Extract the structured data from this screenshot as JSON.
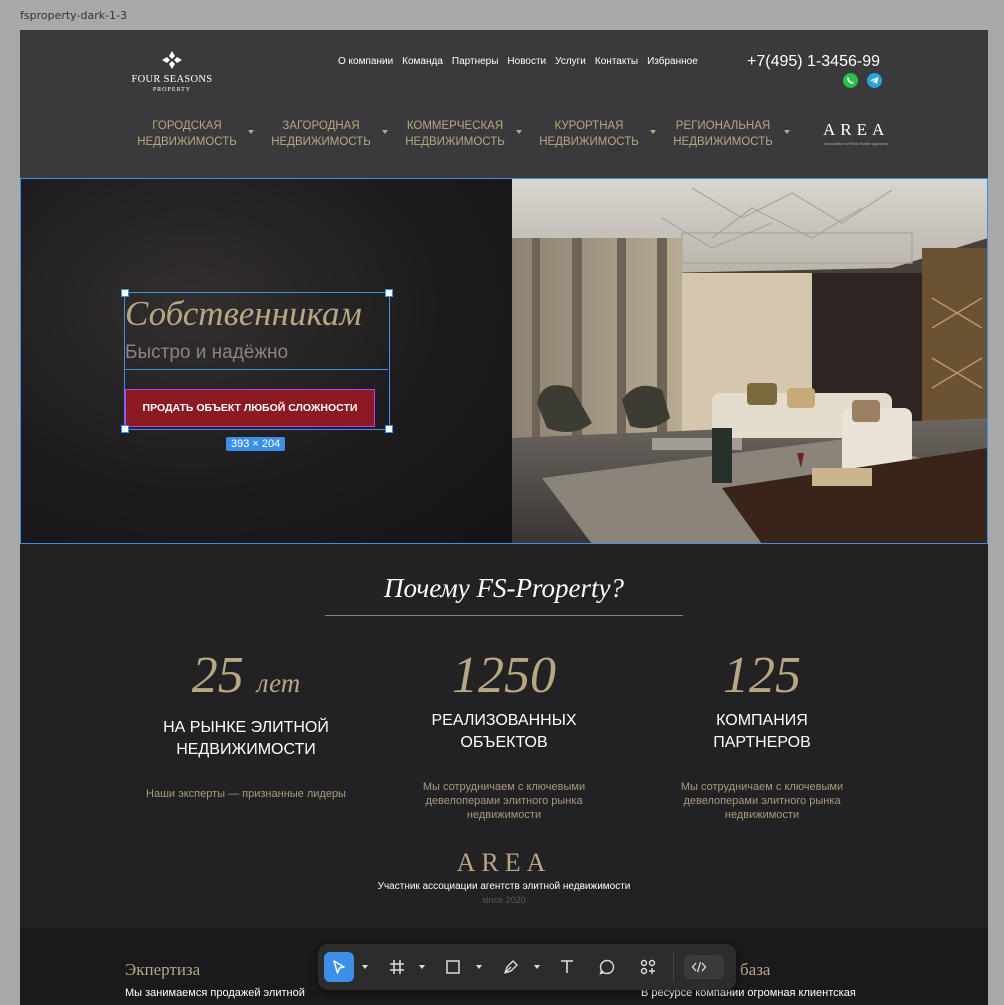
{
  "frame": {
    "title": "fsproperty-dark-1-3"
  },
  "logo": {
    "name": "FOUR SEASONS",
    "sub": "PROPERTY"
  },
  "topnav": [
    "О компании",
    "Команда",
    "Партнеры",
    "Новости",
    "Услуги",
    "Контакты",
    "Избранное"
  ],
  "contact": {
    "phone": "+7(495) 1-3456-99"
  },
  "mainnav": [
    {
      "line1": "ГОРОДСКАЯ",
      "line2": "НЕДВИЖИМОСТЬ"
    },
    {
      "line1": "ЗАГОРОДНАЯ",
      "line2": "НЕДВИЖИМОСТЬ"
    },
    {
      "line1": "КОММЕРЧЕСКАЯ",
      "line2": "НЕДВИЖИМОСТЬ"
    },
    {
      "line1": "КУРОРТНАЯ",
      "line2": "НЕДВИЖИМОСТЬ"
    },
    {
      "line1": "РЕГИОНАЛЬНАЯ",
      "line2": "НЕДВИЖИМОСТЬ"
    }
  ],
  "area_header": {
    "word": "AREA",
    "sub": "Association of Real Estate Agencies"
  },
  "hero": {
    "title": "Собственникам",
    "subtitle": "Быстро и надёжно",
    "button": "ПРОДАТЬ ОБЪЕКТ ЛЮБОЙ СЛОЖНОСТИ",
    "selection_size": "393 × 204"
  },
  "why": {
    "title": "Почему FS-Property?",
    "stats": [
      {
        "number": "25",
        "unit": "лет",
        "cap1": "НА РЫНКЕ ЭЛИТНОЙ",
        "cap2": "НЕДВИЖИМОСТИ",
        "desc": "Наши эксперты — признанные лидеры"
      },
      {
        "number": "1250",
        "unit": "",
        "cap1": "РЕАЛИЗОВАННЫХ",
        "cap2": "ОБЪЕКТОВ",
        "desc": "Мы сотрудничаем с ключевыми девелоперами элитного рынка недвижимости"
      },
      {
        "number": "125",
        "unit": "",
        "cap1": "КОМПАНИЯ",
        "cap2": "ПАРТНЕРОВ",
        "desc": "Мы сотрудничаем с ключевыми девелоперами элитного рынка недвижимости"
      }
    ]
  },
  "area_mid": {
    "word": "AREA",
    "text": "Участник ассоциации агентств  элитной недвижимости",
    "since": "since 2020"
  },
  "bottom": {
    "exp_title": "Экпертиза",
    "exp_text": "Мы занимаемся продажей элитной",
    "base_title": "база",
    "base_text": "В ресурсе компании огромная клиентская"
  },
  "colors": {
    "accent": "#b7a783",
    "button": "#8c1a22",
    "selection": "#3b8fe6",
    "background": "#222124"
  }
}
